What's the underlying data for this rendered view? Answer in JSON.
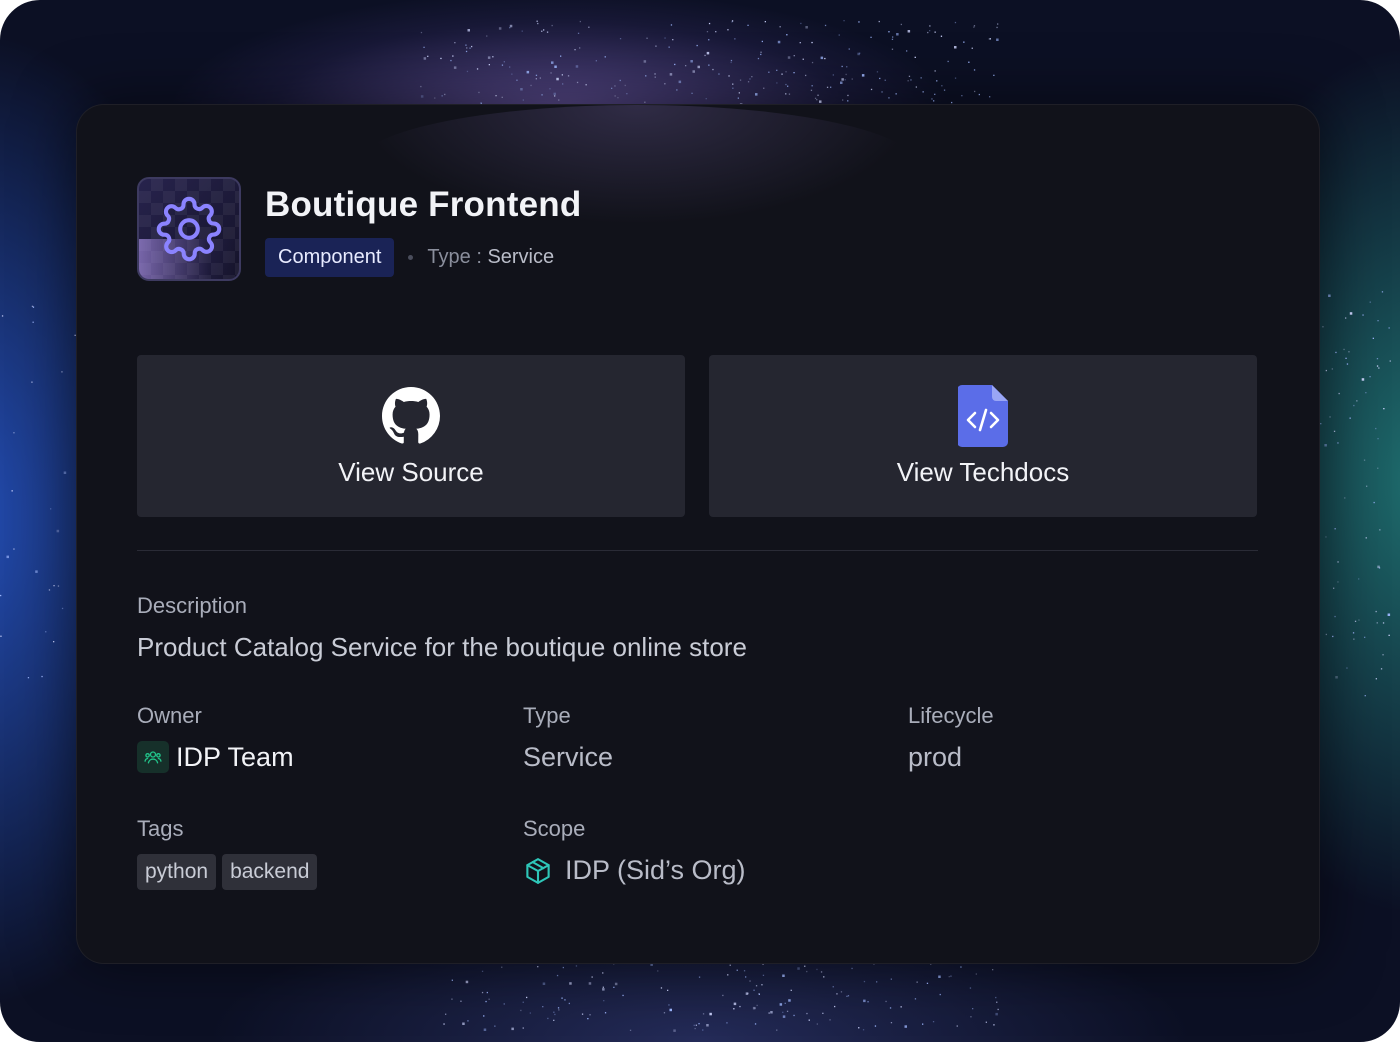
{
  "header": {
    "title": "Boutique Frontend",
    "kind_badge": "Component",
    "type_prefix": "Type : ",
    "type_value": "Service"
  },
  "actions": [
    {
      "label": "View Source",
      "icon": "github-icon"
    },
    {
      "label": "View Techdocs",
      "icon": "techdocs-file-code-icon"
    }
  ],
  "description": {
    "label": "Description",
    "text": "Product Catalog Service for the boutique online store"
  },
  "fields": {
    "owner": {
      "label": "Owner",
      "value": "IDP Team",
      "icon": "team-icon"
    },
    "type": {
      "label": "Type",
      "value": "Service"
    },
    "lifecycle": {
      "label": "Lifecycle",
      "value": "prod"
    },
    "tags": {
      "label": "Tags",
      "items": [
        "python",
        "backend"
      ]
    },
    "scope": {
      "label": "Scope",
      "value": "IDP (Sid’s Org)",
      "icon": "cube-icon"
    }
  },
  "colors": {
    "badge_bg": "#1a2356",
    "techdocs_icon": "#5b6de8",
    "owner_icon": "#22c48a",
    "scope_icon": "#2ec6b8",
    "gear_icon": "#8b83ff"
  }
}
